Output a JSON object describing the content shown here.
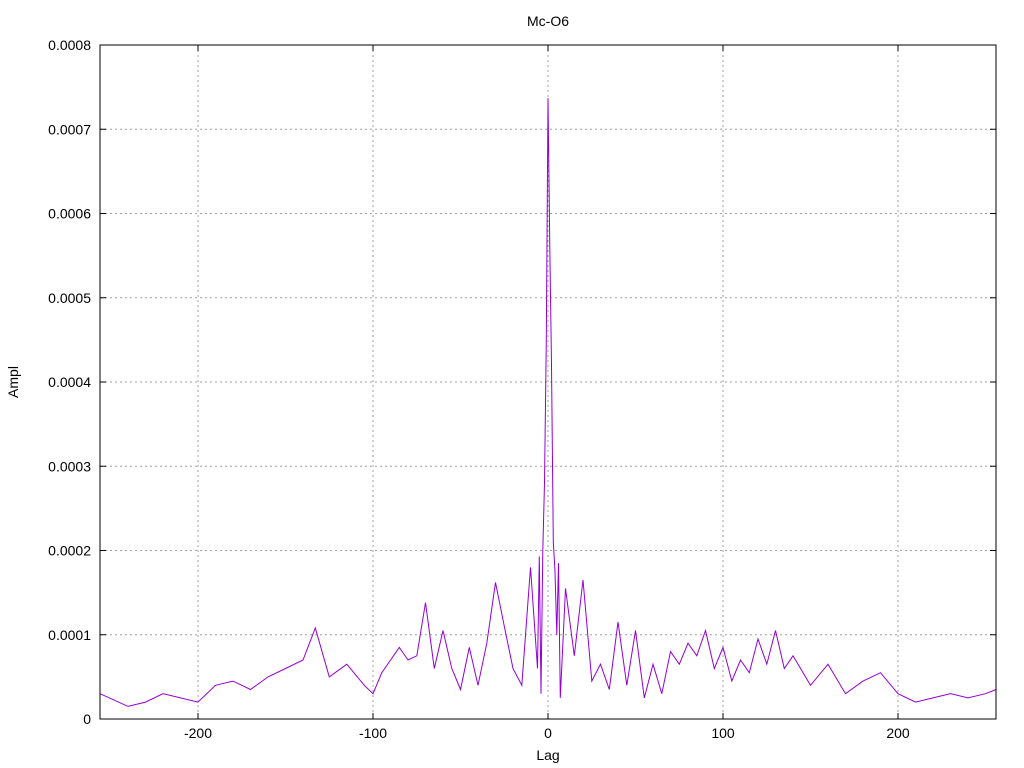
{
  "chart_data": {
    "type": "line",
    "title": "Mc-O6",
    "xlabel": "Lag",
    "ylabel": "Ampl",
    "xlim": [
      -256,
      256
    ],
    "ylim": [
      0,
      0.0008
    ],
    "x_ticks": [
      -200,
      -100,
      0,
      100,
      200
    ],
    "y_ticks": [
      0,
      0.0001,
      0.0002,
      0.0003,
      0.0004,
      0.0005,
      0.0006,
      0.0007,
      0.0008
    ],
    "x_tick_labels": [
      "-200",
      "-100",
      "0",
      "100",
      "200"
    ],
    "y_tick_labels": [
      "0",
      "0.0001",
      "0.0002",
      "0.0003",
      "0.0004",
      "0.0005",
      "0.0006",
      "0.0007",
      "0.0008"
    ],
    "grid": true,
    "series": [
      {
        "color": "#9400d3",
        "x": [
          -256,
          -240,
          -230,
          -220,
          -210,
          -200,
          -190,
          -180,
          -170,
          -160,
          -150,
          -140,
          -133,
          -125,
          -115,
          -105,
          -100,
          -95,
          -85,
          -80,
          -75,
          -70,
          -65,
          -60,
          -55,
          -50,
          -45,
          -40,
          -35,
          -30,
          -25,
          -20,
          -15,
          -10,
          -6,
          -5,
          -4,
          -3,
          -2,
          -1,
          0,
          1,
          2,
          3,
          4,
          5,
          6,
          7,
          10,
          15,
          20,
          25,
          30,
          35,
          40,
          45,
          50,
          55,
          60,
          65,
          70,
          75,
          80,
          85,
          90,
          95,
          100,
          105,
          110,
          115,
          120,
          125,
          130,
          135,
          140,
          150,
          160,
          170,
          180,
          190,
          200,
          210,
          220,
          230,
          240,
          250,
          256
        ],
        "y": [
          3e-05,
          1.5e-05,
          2e-05,
          3e-05,
          2.5e-05,
          2e-05,
          4e-05,
          4.5e-05,
          3.5e-05,
          5e-05,
          6e-05,
          7e-05,
          0.000108,
          5e-05,
          6.5e-05,
          4e-05,
          3e-05,
          5.5e-05,
          8.5e-05,
          7e-05,
          7.5e-05,
          0.000138,
          6e-05,
          0.000105,
          6e-05,
          3.5e-05,
          8.5e-05,
          4e-05,
          9e-05,
          0.000162,
          0.00011,
          6e-05,
          4e-05,
          0.00018,
          6e-05,
          0.000193,
          3e-05,
          0.0002,
          0.00028,
          0.00045,
          0.000737,
          0.00056,
          0.00042,
          0.00021,
          0.000175,
          0.0001,
          0.000185,
          2.5e-05,
          0.000155,
          7.5e-05,
          0.000165,
          4.5e-05,
          6.5e-05,
          3.5e-05,
          0.000115,
          4e-05,
          0.000105,
          2.5e-05,
          6.5e-05,
          3e-05,
          8e-05,
          6.5e-05,
          9e-05,
          7.5e-05,
          0.000105,
          6e-05,
          8.5e-05,
          4.5e-05,
          7e-05,
          5.5e-05,
          9.5e-05,
          6.5e-05,
          0.000105,
          6e-05,
          7.5e-05,
          4e-05,
          6.5e-05,
          3e-05,
          4.5e-05,
          5.5e-05,
          3e-05,
          2e-05,
          2.5e-05,
          3e-05,
          2.5e-05,
          3e-05,
          3.5e-05
        ]
      }
    ]
  }
}
